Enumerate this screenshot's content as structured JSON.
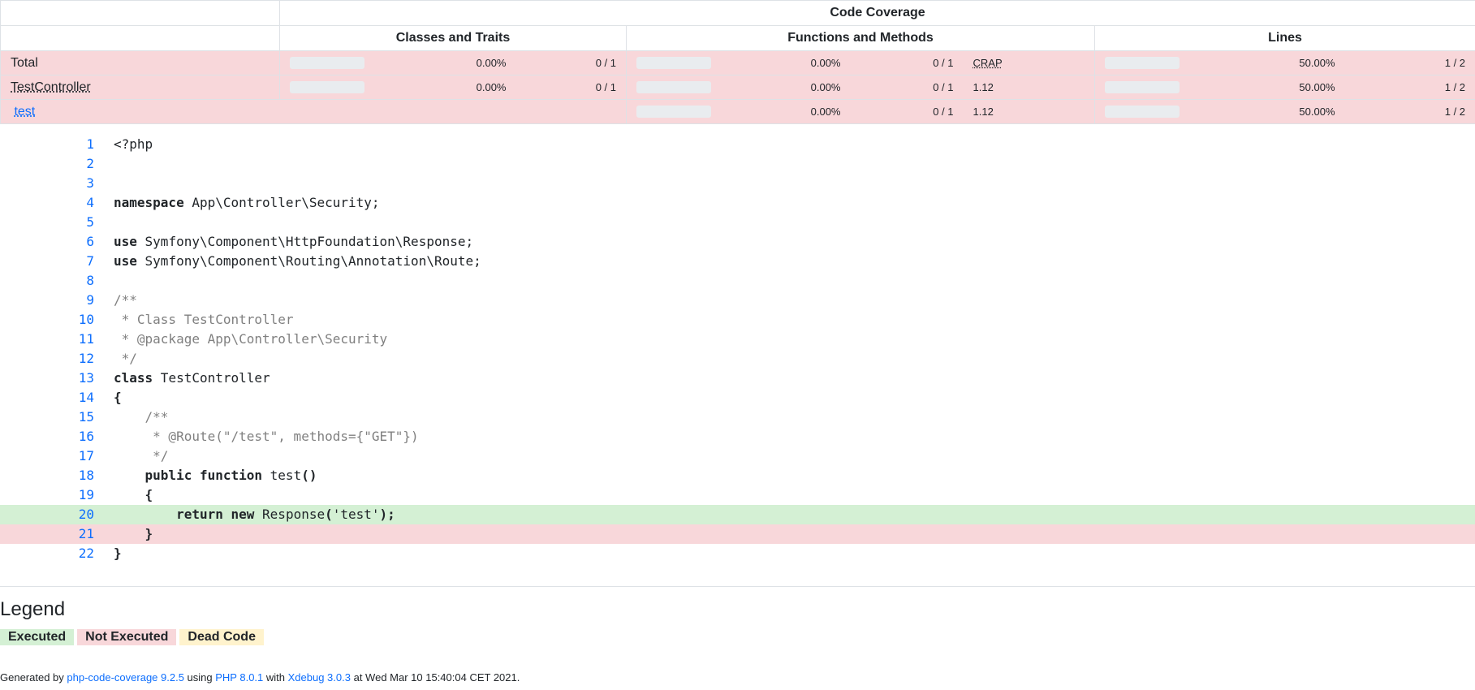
{
  "header": {
    "group_title": "Code Coverage",
    "col_classes": "Classes and Traits",
    "col_functions": "Functions and Methods",
    "col_lines": "Lines"
  },
  "rows": [
    {
      "name": "Total",
      "classes_bar_percent": 0,
      "classes_pct": "0.00%",
      "classes_ratio": "0 / 1",
      "functions_bar_percent": 0,
      "functions_pct": "0.00%",
      "functions_ratio": "0 / 1",
      "crap": "CRAP",
      "lines_bar_percent": 50,
      "lines_pct": "50.00%",
      "lines_ratio": "1 / 2"
    },
    {
      "name": "TestController",
      "classes_bar_percent": 0,
      "classes_pct": "0.00%",
      "classes_ratio": "0 / 1",
      "functions_bar_percent": 0,
      "functions_pct": "0.00%",
      "functions_ratio": "0 / 1",
      "crap": "1.12",
      "lines_bar_percent": 50,
      "lines_pct": "50.00%",
      "lines_ratio": "1 / 2"
    },
    {
      "name": "test",
      "functions_bar_percent": 0,
      "functions_pct": "0.00%",
      "functions_ratio": "0 / 1",
      "crap": "1.12",
      "lines_bar_percent": 50,
      "lines_pct": "50.00%",
      "lines_ratio": "1 / 2"
    }
  ],
  "code_lines": [
    {
      "n": "1",
      "status": "",
      "tokens": [
        {
          "t": "<?php",
          "c": ""
        }
      ]
    },
    {
      "n": "2",
      "status": "",
      "tokens": []
    },
    {
      "n": "3",
      "status": "",
      "tokens": []
    },
    {
      "n": "4",
      "status": "",
      "tokens": [
        {
          "t": "namespace",
          "c": "kw"
        },
        {
          "t": " App\\Controller\\Security;",
          "c": ""
        }
      ]
    },
    {
      "n": "5",
      "status": "",
      "tokens": []
    },
    {
      "n": "6",
      "status": "",
      "tokens": [
        {
          "t": "use",
          "c": "kw"
        },
        {
          "t": " Symfony\\Component\\HttpFoundation\\Response;",
          "c": ""
        }
      ]
    },
    {
      "n": "7",
      "status": "",
      "tokens": [
        {
          "t": "use",
          "c": "kw"
        },
        {
          "t": " Symfony\\Component\\Routing\\Annotation\\Route;",
          "c": ""
        }
      ]
    },
    {
      "n": "8",
      "status": "",
      "tokens": []
    },
    {
      "n": "9",
      "status": "",
      "tokens": [
        {
          "t": "/**",
          "c": "cm"
        }
      ]
    },
    {
      "n": "10",
      "status": "",
      "tokens": [
        {
          "t": " * Class TestController",
          "c": "cm"
        }
      ]
    },
    {
      "n": "11",
      "status": "",
      "tokens": [
        {
          "t": " * @package App\\Controller\\Security",
          "c": "cm"
        }
      ]
    },
    {
      "n": "12",
      "status": "",
      "tokens": [
        {
          "t": " */",
          "c": "cm"
        }
      ]
    },
    {
      "n": "13",
      "status": "",
      "tokens": [
        {
          "t": "class",
          "c": "kw"
        },
        {
          "t": " TestController",
          "c": ""
        }
      ]
    },
    {
      "n": "14",
      "status": "",
      "tokens": [
        {
          "t": "{",
          "c": "kw"
        }
      ]
    },
    {
      "n": "15",
      "status": "",
      "tokens": [
        {
          "t": "    /**",
          "c": "cm"
        }
      ]
    },
    {
      "n": "16",
      "status": "",
      "tokens": [
        {
          "t": "     * @Route(\"/test\", methods={\"GET\"})",
          "c": "cm"
        }
      ]
    },
    {
      "n": "17",
      "status": "",
      "tokens": [
        {
          "t": "     */",
          "c": "cm"
        }
      ]
    },
    {
      "n": "18",
      "status": "",
      "tokens": [
        {
          "t": "    ",
          "c": ""
        },
        {
          "t": "public",
          "c": "kw"
        },
        {
          "t": " ",
          "c": ""
        },
        {
          "t": "function",
          "c": "kw"
        },
        {
          "t": " test",
          "c": ""
        },
        {
          "t": "()",
          "c": "kw"
        }
      ]
    },
    {
      "n": "19",
      "status": "",
      "tokens": [
        {
          "t": "    {",
          "c": "kw"
        }
      ]
    },
    {
      "n": "20",
      "status": "exec",
      "tokens": [
        {
          "t": "        ",
          "c": ""
        },
        {
          "t": "return",
          "c": "kw"
        },
        {
          "t": " ",
          "c": ""
        },
        {
          "t": "new",
          "c": "kw"
        },
        {
          "t": " Response",
          "c": ""
        },
        {
          "t": "(",
          "c": "kw"
        },
        {
          "t": "'test'",
          "c": "str"
        },
        {
          "t": ");",
          "c": "kw"
        }
      ]
    },
    {
      "n": "21",
      "status": "notexec",
      "tokens": [
        {
          "t": "    }",
          "c": "kw"
        }
      ]
    },
    {
      "n": "22",
      "status": "",
      "tokens": [
        {
          "t": "}",
          "c": "kw"
        }
      ]
    }
  ],
  "legend": {
    "title": "Legend",
    "executed": "Executed",
    "not_executed": "Not Executed",
    "dead_code": "Dead Code"
  },
  "footer": {
    "generated_by": "Generated by ",
    "tool_link": "php-code-coverage 9.2.5",
    "using": " using ",
    "php_link": "PHP 8.0.1",
    "with": " with ",
    "xdebug_link": "Xdebug 3.0.3",
    "at": " at Wed Mar 10 15:40:04 CET 2021."
  }
}
